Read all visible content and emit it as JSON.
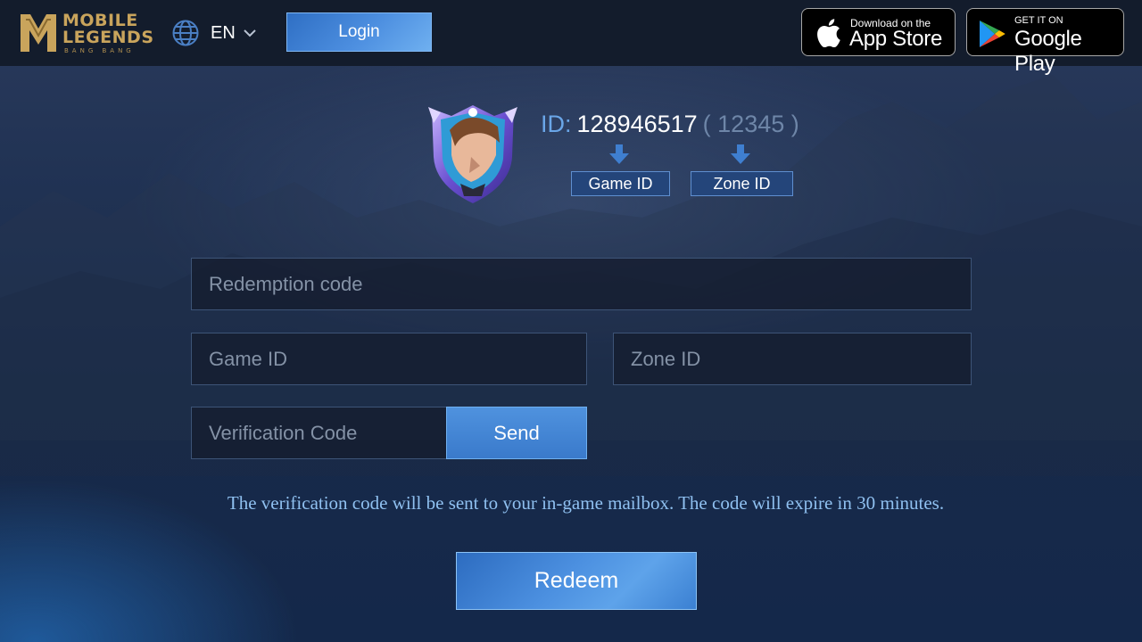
{
  "header": {
    "logo": {
      "line1": "MOBILE",
      "line2": "LEGENDS",
      "line3": "BANG BANG"
    },
    "language": {
      "code": "EN"
    },
    "login_label": "Login",
    "app_store": {
      "small": "Download on the",
      "big": "App Store"
    },
    "google_play": {
      "small": "GET IT ON",
      "big": "Google Play"
    }
  },
  "profile": {
    "id_label": "ID:",
    "game_id": "128946517",
    "zone_id_display": "( 12345 )",
    "game_id_tag": "Game ID",
    "zone_id_tag": "Zone ID"
  },
  "form": {
    "redemption_placeholder": "Redemption code",
    "game_id_placeholder": "Game ID",
    "zone_id_placeholder": "Zone ID",
    "verification_placeholder": "Verification Code",
    "send_label": "Send",
    "note": "The verification code will be sent to your in-game mailbox. The code will expire in 30 minutes.",
    "redeem_label": "Redeem"
  },
  "colors": {
    "accent": "#4d8fe0",
    "logo_gold": "#c9a45c",
    "id_label": "#6aa6e8"
  }
}
